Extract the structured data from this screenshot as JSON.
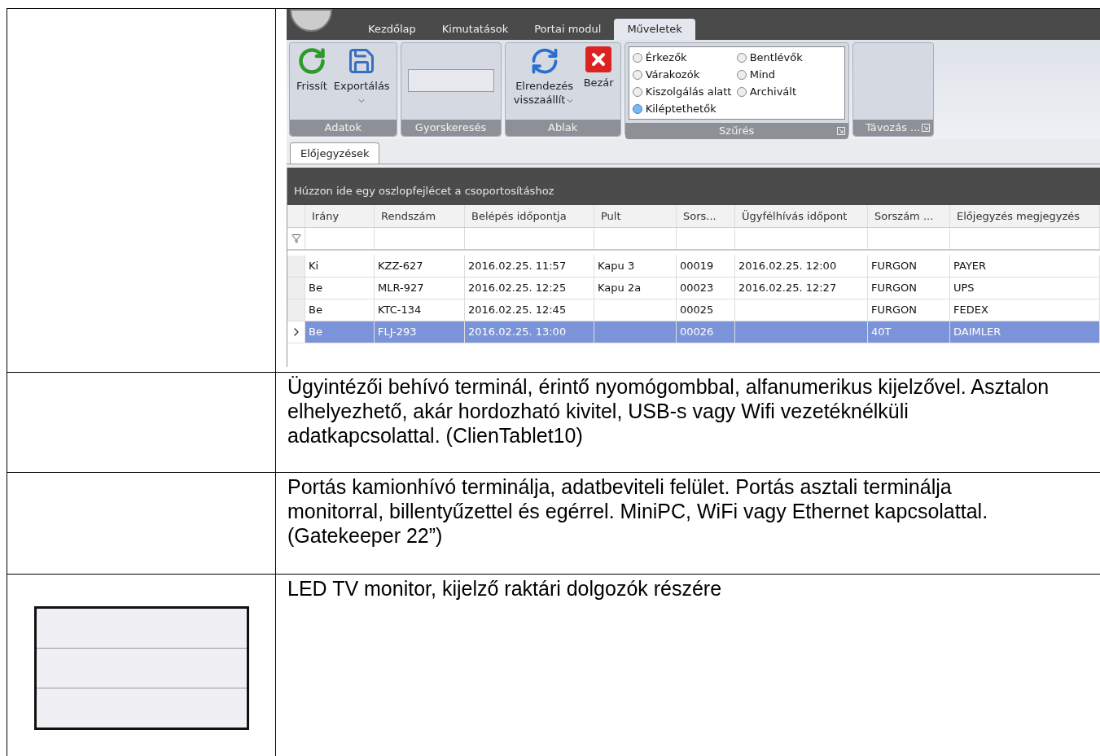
{
  "app": {
    "ribbon_tabs": [
      {
        "label": "Kezdőlap",
        "selected": false
      },
      {
        "label": "Kimutatások",
        "selected": false
      },
      {
        "label": "Portai modul",
        "selected": false
      },
      {
        "label": "Műveletek",
        "selected": true
      }
    ],
    "ribbon_groups": [
      {
        "kind": "buttons",
        "title": "Adatok",
        "launcher": false,
        "buttons": [
          {
            "kind": "refresh",
            "label": "Frissít",
            "dropdown": false
          },
          {
            "kind": "save",
            "label": "Exportálás",
            "dropdown": true
          }
        ]
      },
      {
        "kind": "search",
        "title": "Gyorskeresés",
        "launcher": false
      },
      {
        "kind": "buttons",
        "title": "Ablak",
        "launcher": false,
        "buttons": [
          {
            "kind": "reset",
            "label": "Elrendezés visszaállít",
            "dropdown": true
          },
          {
            "kind": "close",
            "label": "Bezár",
            "dropdown": false
          }
        ]
      },
      {
        "kind": "radios",
        "title": "Szűrés",
        "launcher": true,
        "options": [
          {
            "label": "Érkezők",
            "selected": false
          },
          {
            "label": "Bentlévők",
            "selected": false
          },
          {
            "label": "Várakozók",
            "selected": false
          },
          {
            "label": "Mind",
            "selected": false
          },
          {
            "label": "Kiszolgálás alatt",
            "selected": false
          },
          {
            "label": "Archivált",
            "selected": false
          },
          {
            "label": "Kiléptethetők",
            "selected": true
          }
        ]
      },
      {
        "kind": "empty",
        "title": "Távozás ...",
        "launcher": true
      }
    ],
    "doc_tabs": [
      {
        "label": "Előjegyzések",
        "selected": true
      }
    ],
    "group_panel": "Húzzon ide egy oszlopfejlécet a csoportosításhoz",
    "columns": [
      "Irány",
      "Rendszám",
      "Belépés időpontja",
      "Pult",
      "Sors...",
      "Ügyfélhívás időpont",
      "Sorszám ...",
      "Előjegyzés megjegyzés"
    ],
    "rows": [
      {
        "selected": false,
        "cells": [
          "Ki",
          "KZZ-627",
          "2016.02.25. 11:57",
          "Kapu 3",
          "00019",
          "2016.02.25. 12:00",
          "FURGON",
          "PAYER"
        ]
      },
      {
        "selected": false,
        "cells": [
          "Be",
          "MLR-927",
          "2016.02.25. 12:25",
          "Kapu 2a",
          "00023",
          "2016.02.25. 12:27",
          "FURGON",
          "UPS"
        ]
      },
      {
        "selected": false,
        "cells": [
          "Be",
          "KTC-134",
          "2016.02.25. 12:45",
          "",
          "00025",
          "",
          "FURGON",
          "FEDEX"
        ]
      },
      {
        "selected": true,
        "cells": [
          "Be",
          "FLJ-293",
          "2016.02.25. 13:00",
          "",
          "00026",
          "",
          "40T",
          "DAIMLER"
        ]
      }
    ]
  },
  "descriptions": [
    {
      "kind": "text",
      "text": "Ügyintézői behívó terminál, érintő nyomógombbal, alfanumerikus kijelzővel. Asztalon elhelyezhető, akár hordozható kivitel, USB-s vagy Wifi vezetéknélküli adatkapcsolattal. (ClienTablet10)"
    },
    {
      "kind": "text",
      "text": "Portás kamionhívó terminálja, adatbeviteli felület. Portás asztali terminálja monitorral, billentyűzettel és egérrel. MiniPC, WiFi vagy Ethernet kapcsolattal. (Gatekeeper 22”)"
    },
    {
      "kind": "photo",
      "text": "LED TV monitor, kijelző raktári dolgozók részére"
    }
  ]
}
